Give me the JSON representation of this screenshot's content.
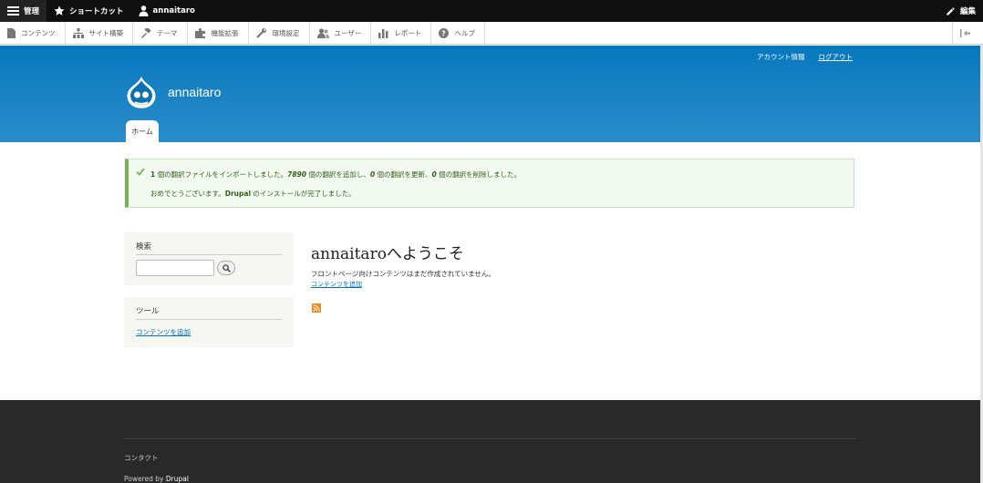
{
  "toolbar": {
    "manage": "管理",
    "shortcuts": "ショートカット",
    "user": "annaitaro",
    "edit": "編集"
  },
  "admin_menu": [
    {
      "label": "コンテンツ",
      "icon": "content-icon"
    },
    {
      "label": "サイト構築",
      "icon": "structure-icon"
    },
    {
      "label": "テーマ",
      "icon": "appearance-icon"
    },
    {
      "label": "機能拡張",
      "icon": "extend-icon"
    },
    {
      "label": "環境設定",
      "icon": "config-icon"
    },
    {
      "label": "ユーザー",
      "icon": "people-icon"
    },
    {
      "label": "レポート",
      "icon": "reports-icon"
    },
    {
      "label": "ヘルプ",
      "icon": "help-icon"
    }
  ],
  "secondary_menu": {
    "account": "アカウント情報",
    "logout": "ログアウト"
  },
  "site": {
    "name": "annaitaro",
    "home_tab": "ホーム"
  },
  "message": {
    "count1": "1",
    "part1": " 個の翻訳ファイルをインポートしました。",
    "count2": "7890",
    "part2": " 個の翻訳を追加し、",
    "count3": "0",
    "part3": " 個の翻訳を更新、",
    "count4": "0",
    "part4": " 個の翻訳を削除しました。",
    "line2_pre": "おめでとうございます。",
    "line2_brand": "Drupal",
    "line2_post": " のインストールが完了しました。"
  },
  "sidebar": {
    "search_title": "検索",
    "tools_title": "ツール",
    "tools_link": "コンテンツを追加"
  },
  "main": {
    "title": "annaitaroへようこそ",
    "text": "フロントページ向けコンテンツはまだ作成されていません。",
    "link": "コンテンツを追加"
  },
  "footer": {
    "contact": "コンタクト",
    "powered_pre": "Powered by ",
    "powered_brand": "Drupal"
  },
  "colors": {
    "header_blue": "#0678be",
    "footer_bg": "#292929",
    "link": "#0071b3",
    "message_border": "#77b259"
  }
}
